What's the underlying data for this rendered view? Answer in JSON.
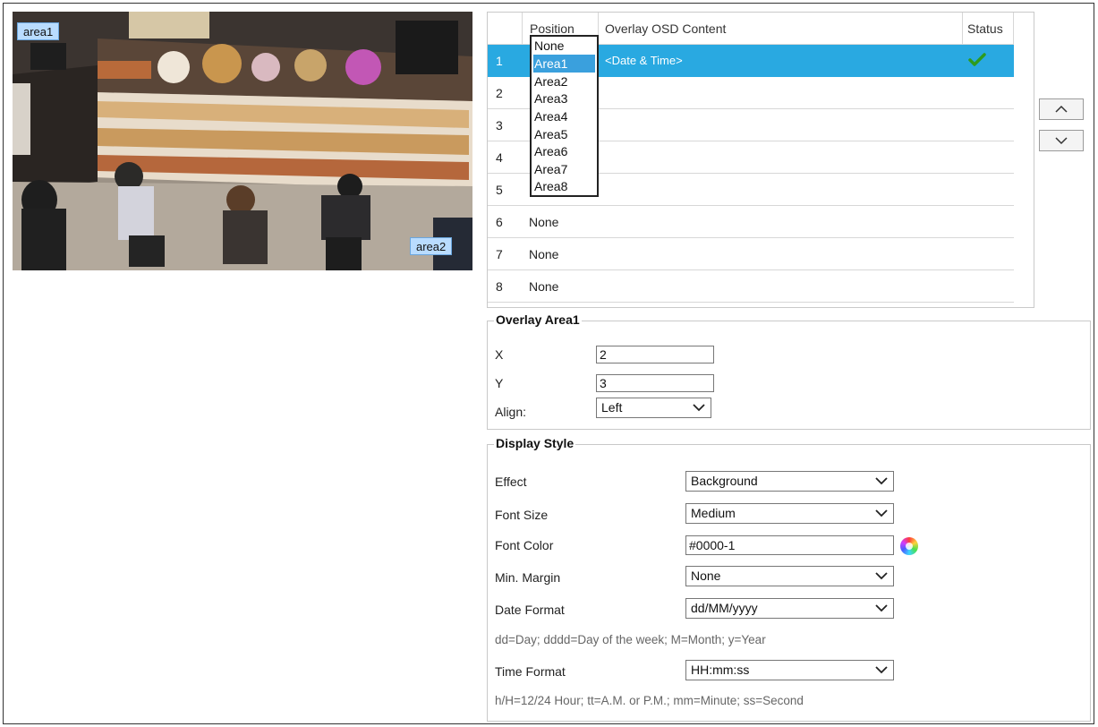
{
  "preview": {
    "overlay_tags": [
      "area1",
      "area2"
    ]
  },
  "table": {
    "headers": {
      "position": "Position",
      "osd": "Overlay OSD Content",
      "status": "Status"
    },
    "rows": [
      {
        "num": "1",
        "position": "",
        "osd": "<Date & Time>",
        "status": "check"
      },
      {
        "num": "2",
        "position": "",
        "osd": ""
      },
      {
        "num": "3",
        "position": "",
        "osd": ""
      },
      {
        "num": "4",
        "position": "",
        "osd": ""
      },
      {
        "num": "5",
        "position": "",
        "osd": ""
      },
      {
        "num": "6",
        "position": "None",
        "osd": ""
      },
      {
        "num": "7",
        "position": "None",
        "osd": ""
      },
      {
        "num": "8",
        "position": "None",
        "osd": ""
      }
    ],
    "position_dropdown": {
      "options": [
        "None",
        "Area1",
        "Area2",
        "Area3",
        "Area4",
        "Area5",
        "Area6",
        "Area7",
        "Area8"
      ],
      "highlighted": "Area1"
    },
    "selected_row_color": "#29a9e1",
    "status_check_color": "#2e9b1e"
  },
  "overlay_area": {
    "title": "Overlay Area1",
    "x_label": "X",
    "x_value": "2",
    "y_label": "Y",
    "y_value": "3",
    "align_label": "Align:",
    "align_value": "Left"
  },
  "display_style": {
    "title": "Display Style",
    "effect_label": "Effect",
    "effect_value": "Background",
    "font_size_label": "Font Size",
    "font_size_value": "Medium",
    "font_color_label": "Font Color",
    "font_color_value": "#0000-1",
    "min_margin_label": "Min. Margin",
    "min_margin_value": "None",
    "date_format_label": "Date Format",
    "date_format_value": "dd/MM/yyyy",
    "date_hint": "dd=Day; dddd=Day of the week; M=Month; y=Year",
    "time_format_label": "Time Format",
    "time_format_value": "HH:mm:ss",
    "time_hint": "h/H=12/24 Hour; tt=A.M. or P.M.; mm=Minute; ss=Second"
  },
  "icons": {
    "move_up": "chevron-up-icon",
    "move_down": "chevron-down-icon",
    "color_picker": "color-wheel-icon"
  }
}
